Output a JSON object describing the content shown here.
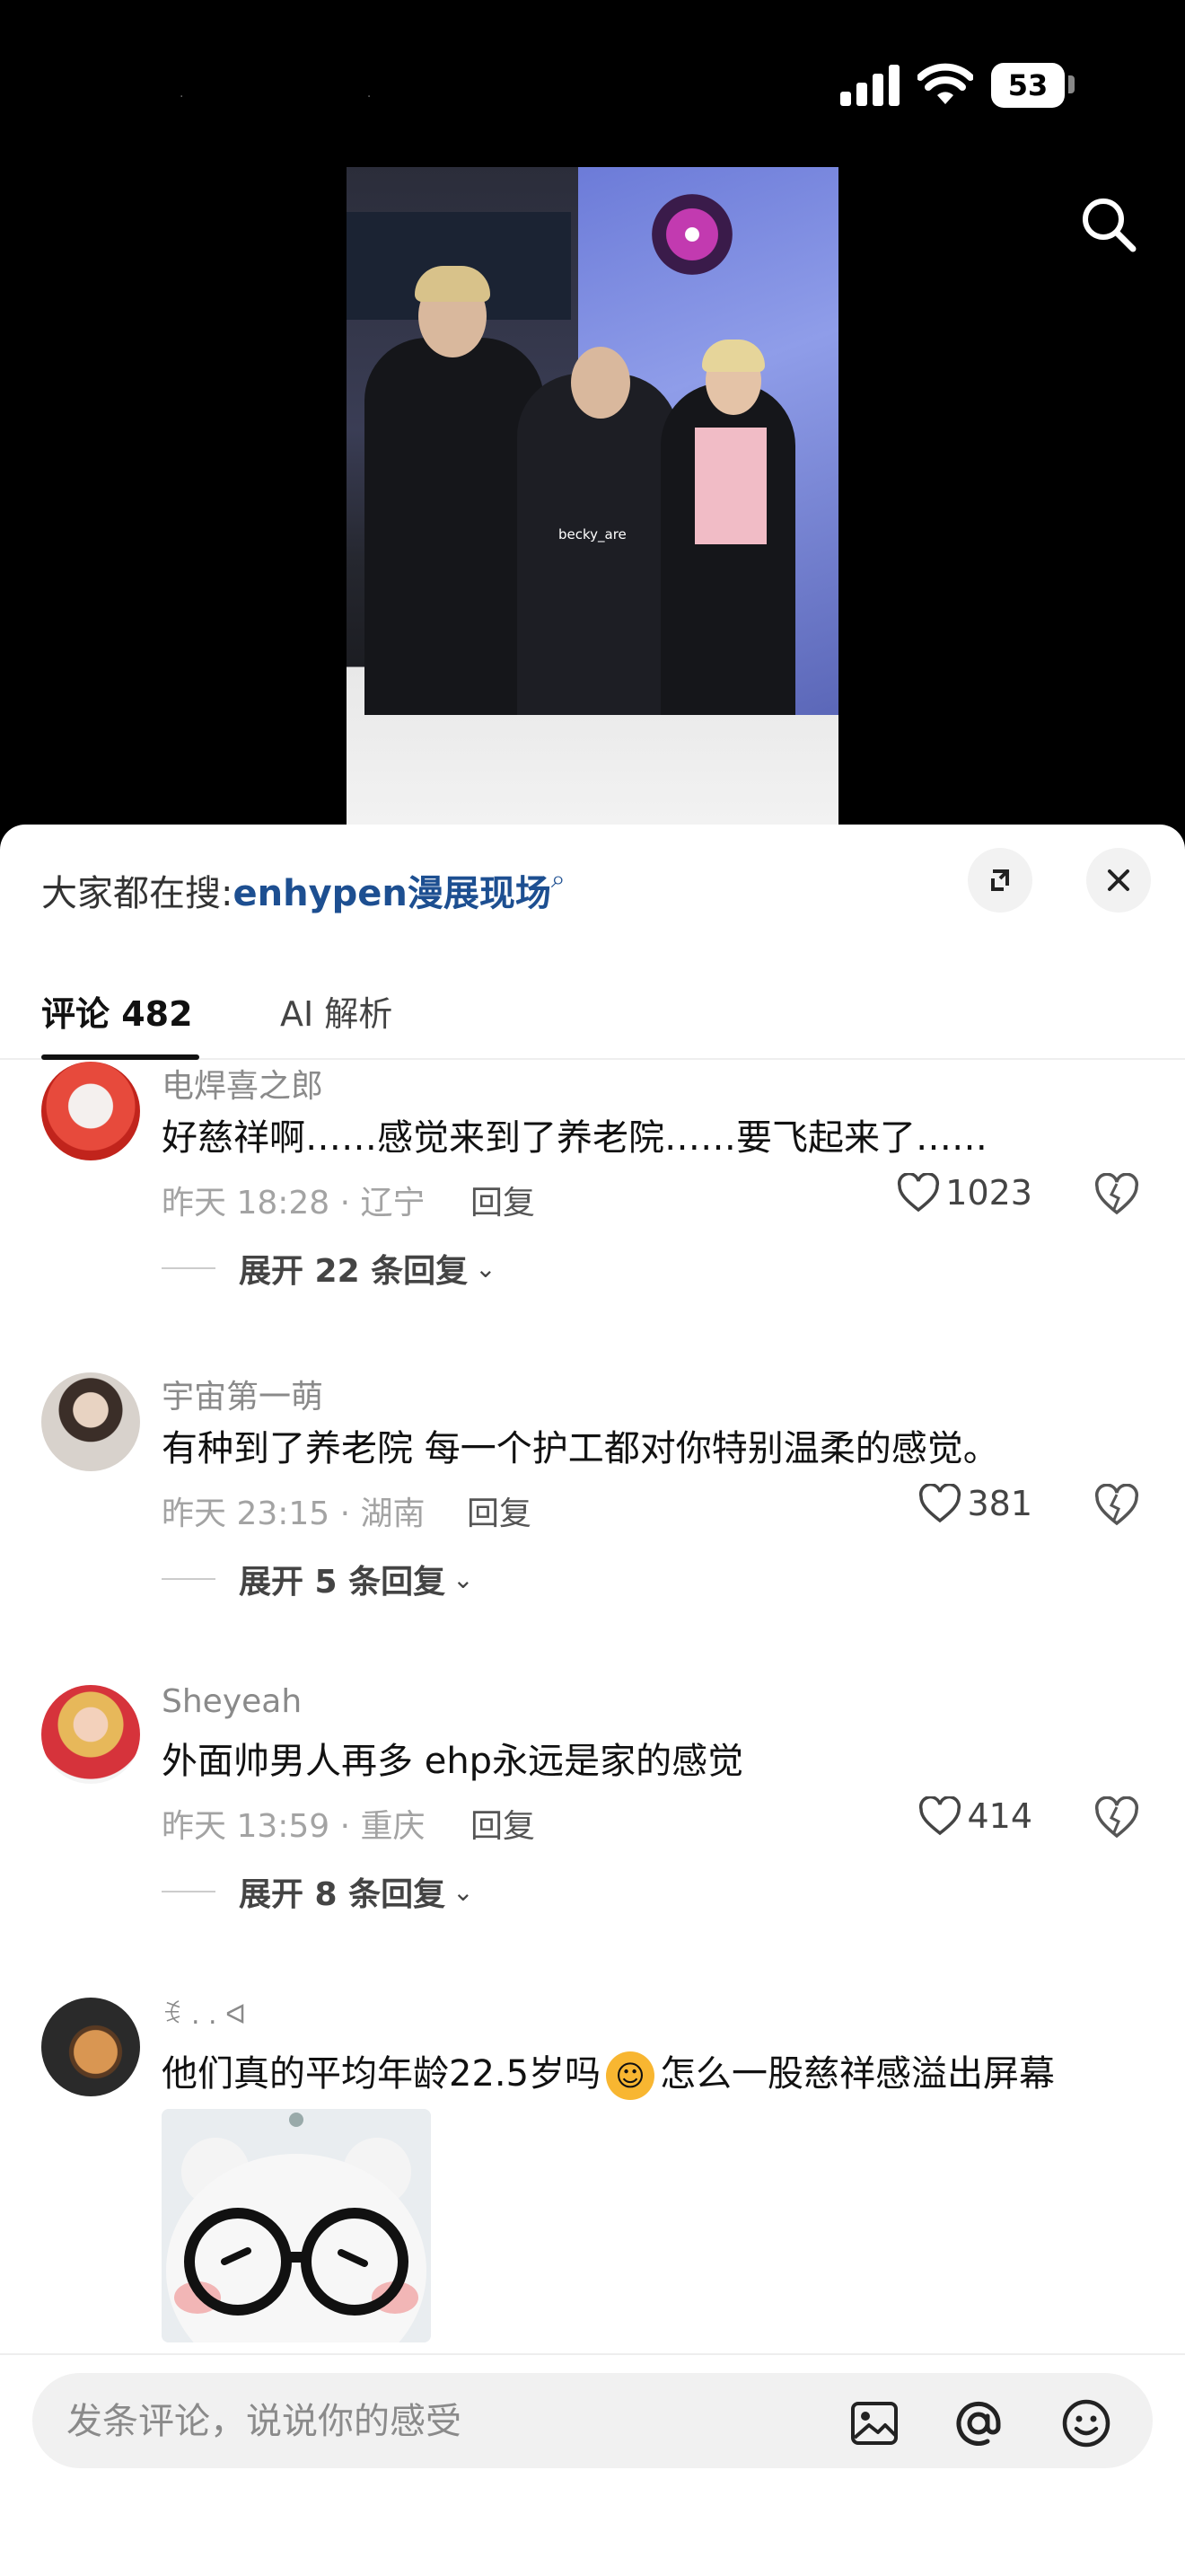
{
  "status_bar": {
    "battery": "53"
  },
  "video": {
    "watermark": "becky_are"
  },
  "sheet": {
    "search_prefix": "大家都在搜:",
    "search_keyword": "enhypen漫展现场"
  },
  "tabs": [
    {
      "label": "评论 482"
    },
    {
      "label": "AI 解析"
    }
  ],
  "comments": [
    {
      "user": "电焊喜之郎",
      "text": "好慈祥啊……感觉来到了养老院……要飞起来了……",
      "meta": "昨天 18:28 · 辽宁",
      "reply": "回复",
      "likes": "1023",
      "expand": "展开 22 条回复"
    },
    {
      "user": "宇宙第一萌",
      "text": "有种到了养老院 每一个护工都对你特别温柔的感觉。",
      "meta": "昨天 23:15 · 湖南",
      "reply": "回复",
      "likes": "381",
      "expand": "展开 5 条回复"
    },
    {
      "user": "Sheyeah",
      "text": "外面帅男人再多 ehp永远是家的感觉",
      "meta": "昨天 13:59 · 重庆",
      "reply": "回复",
      "likes": "414",
      "expand": "展开 8 条回复"
    },
    {
      "user": "ꉂ . . ᐊ",
      "text_before": "他们真的平均年龄22.5岁吗",
      "text_after": "怎么一股慈祥感溢出屏幕"
    }
  ],
  "input": {
    "placeholder": "发条评论，说说你的感受"
  }
}
